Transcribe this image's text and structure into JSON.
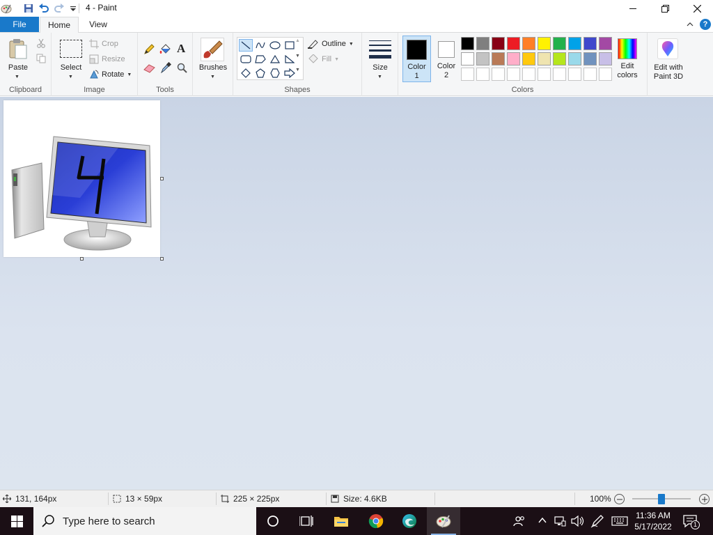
{
  "window": {
    "title": "4 - Paint"
  },
  "tabs": {
    "file": "File",
    "home": "Home",
    "view": "View"
  },
  "ribbon": {
    "clipboard": {
      "group_label": "Clipboard",
      "paste": "Paste"
    },
    "image": {
      "group_label": "Image",
      "select": "Select",
      "crop": "Crop",
      "resize": "Resize",
      "rotate": "Rotate"
    },
    "tools": {
      "group_label": "Tools"
    },
    "brushes": {
      "label": "Brushes"
    },
    "shapes": {
      "group_label": "Shapes",
      "outline": "Outline",
      "fill": "Fill"
    },
    "size": {
      "label": "Size"
    },
    "colors": {
      "group_label": "Colors",
      "color1_line1": "Color",
      "color1_line2": "1",
      "color2_line1": "Color",
      "color2_line2": "2",
      "edit_line1": "Edit",
      "edit_line2": "colors",
      "paint3d_line1": "Edit with",
      "paint3d_line2": "Paint 3D",
      "color1": "#000000",
      "color2": "#ffffff",
      "palette_row1": [
        "#000000",
        "#7f7f7f",
        "#880015",
        "#ed1c24",
        "#ff7f27",
        "#fff200",
        "#22b14c",
        "#00a2e8",
        "#3f48cc",
        "#a349a4"
      ],
      "palette_row2": [
        "#ffffff",
        "#c3c3c3",
        "#b97a57",
        "#ffaec9",
        "#ffc90e",
        "#efe4b0",
        "#b5e61d",
        "#99d9ea",
        "#7092be",
        "#c8bfe7"
      ]
    }
  },
  "canvas": {
    "drawn_text": "4"
  },
  "status": {
    "cursor_pos": "131, 164px",
    "selection_size": "13 × 59px",
    "image_size": "225 × 225px",
    "file_size": "Size: 4.6KB",
    "zoom": "100%",
    "zoom_fraction": 0.5
  },
  "taskbar": {
    "search_placeholder": "Type here to search",
    "time": "11:36 AM",
    "date": "5/17/2022",
    "notification_count": "1"
  }
}
